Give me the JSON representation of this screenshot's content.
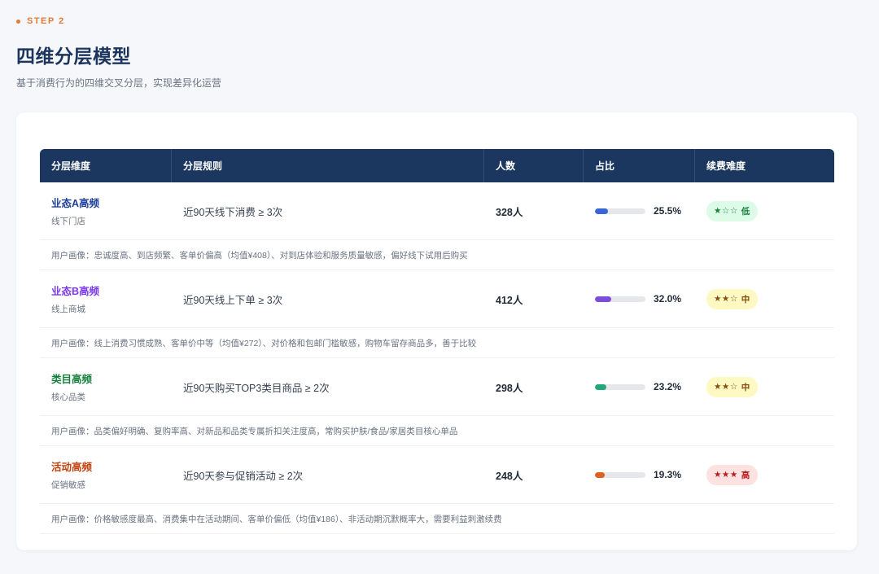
{
  "header": {
    "step": "STEP 2",
    "title": "四维分层模型",
    "subtitle": "基于消费行为的四维交叉分层，实现差异化运营"
  },
  "table": {
    "columns": [
      "分层维度",
      "分层规则",
      "人数",
      "占比",
      "续费难度"
    ],
    "rows": [
      {
        "name": "业态A高频",
        "sub": "线下门店",
        "rule": "近90天线下消费 ≥ 3次",
        "count": "328人",
        "percent_label": "25.5%",
        "percent": 25.5,
        "stars": "★☆☆",
        "difficulty": "低",
        "persona": "用户画像：忠诚度高、到店频繁、客单价偏高（均值¥408）、对到店体验和服务质量敏感，偏好线下试用后购买",
        "name_color": "#1f3f9a",
        "bar_color": "#3866d8",
        "badge_bg": "#dcfce7",
        "badge_color": "#15803d"
      },
      {
        "name": "业态B高频",
        "sub": "线上商城",
        "rule": "近90天线上下单 ≥ 3次",
        "count": "412人",
        "percent_label": "32.0%",
        "percent": 32.0,
        "stars": "★★☆",
        "difficulty": "中",
        "persona": "用户画像：线上消费习惯成熟、客单价中等（均值¥272）、对价格和包邮门槛敏感，购物车留存商品多，善于比较",
        "name_color": "#7c3aed",
        "bar_color": "#7c4ddb",
        "badge_bg": "#fef9c3",
        "badge_color": "#854d0e"
      },
      {
        "name": "类目高频",
        "sub": "核心品类",
        "rule": "近90天购买TOP3类目商品 ≥ 2次",
        "count": "298人",
        "percent_label": "23.2%",
        "percent": 23.2,
        "stars": "★★☆",
        "difficulty": "中",
        "persona": "用户画像：品类偏好明确、复购率高、对新品和品类专属折扣关注度高，常购买护肤/食品/家居类目核心单品",
        "name_color": "#15803d",
        "bar_color": "#22a67a",
        "badge_bg": "#fef9c3",
        "badge_color": "#854d0e"
      },
      {
        "name": "活动高频",
        "sub": "促销敏感",
        "rule": "近90天参与促销活动 ≥ 2次",
        "count": "248人",
        "percent_label": "19.3%",
        "percent": 19.3,
        "stars": "★★★",
        "difficulty": "高",
        "persona": "用户画像：价格敏感度最高、消费集中在活动期间、客单价偏低（均值¥186）、非活动期沉默概率大，需要利益刺激续费",
        "name_color": "#c2410c",
        "bar_color": "#e0611f",
        "badge_bg": "#fee2e2",
        "badge_color": "#b91c1c"
      }
    ]
  }
}
